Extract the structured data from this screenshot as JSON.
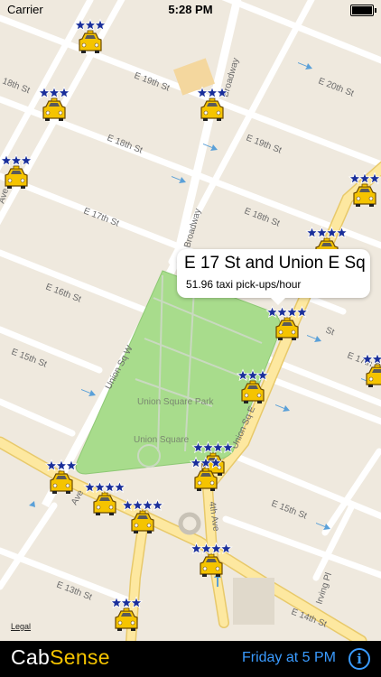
{
  "status_bar": {
    "carrier": "Carrier",
    "time": "5:28 PM"
  },
  "map": {
    "street_labels": [
      "E 20th St",
      "E 19th St",
      "E 19th St",
      "18th St",
      "E 18th St",
      "E 18th St",
      "E 17th St",
      "E 17th St",
      "E 16th St",
      "E 16th St",
      "E 15th St",
      "E 15th St",
      "E 14th St",
      "E 13th St",
      "Broadway",
      "Broadway",
      "Union Sq W",
      "Union Sq E",
      "4th Ave",
      "Irving Pl",
      "Ave",
      "Ave",
      "E 17th St",
      "St"
    ],
    "park_labels": [
      "Union Square Park",
      "Union Square"
    ],
    "taxi_stands": [
      {
        "stars": 3
      },
      {
        "stars": 3
      },
      {
        "stars": 3
      },
      {
        "stars": 3
      },
      {
        "stars": 3
      },
      {
        "stars": 4
      },
      {
        "stars": 4
      },
      {
        "stars": 3
      },
      {
        "stars": 4
      },
      {
        "stars": 3
      },
      {
        "stars": 3
      },
      {
        "stars": 4
      },
      {
        "stars": 4
      },
      {
        "stars": 4
      },
      {
        "stars": 3
      },
      {
        "stars": 3
      }
    ],
    "legal": "Legal"
  },
  "callout": {
    "title": "E 17 St and Union E Sq",
    "subtitle": "51.96 taxi pick-ups/hour"
  },
  "toolbar": {
    "logo_cab": "Cab",
    "logo_sense": "Sense",
    "time_selector": "Friday at 5 PM",
    "info": "i"
  },
  "colors": {
    "map_bg": "#efe9de",
    "park": "#a8dc8c",
    "major_road": "#fde8a0",
    "taxi": "#f5c400",
    "star": "#1a2f9a",
    "toolbar_bg": "#000000",
    "link": "#3a9bff"
  }
}
